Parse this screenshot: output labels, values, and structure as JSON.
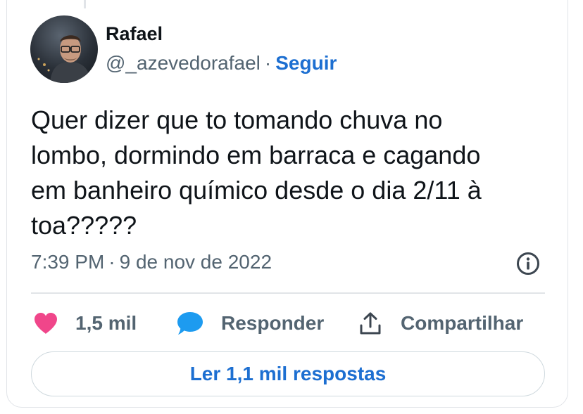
{
  "author": {
    "name": "Rafael",
    "handle": "@_azevedorafael",
    "separator": "·",
    "follow_label": "Seguir"
  },
  "tweet": {
    "lines": [
      "Quer dizer que to tomando chuva no",
      "lombo, dormindo em barraca e cagando",
      "em banheiro químico desde o dia 2/11 à",
      "toa?????"
    ],
    "time": "7:39 PM",
    "separator": "·",
    "date": "9 de nov de 2022"
  },
  "actions": {
    "like": {
      "icon": "heart-icon",
      "label": "1,5 mil",
      "color": "#f0468a"
    },
    "reply": {
      "icon": "speech-bubble-icon",
      "label": "Responder",
      "color": "#1d9bf0"
    },
    "share": {
      "icon": "share-upload-icon",
      "label": "Compartilhar"
    }
  },
  "read_replies_label": "Ler 1,1 mil respostas",
  "colors": {
    "text": "#0f1419",
    "muted": "#536471",
    "link": "#1d6fd1",
    "border": "#e1e4e8"
  }
}
